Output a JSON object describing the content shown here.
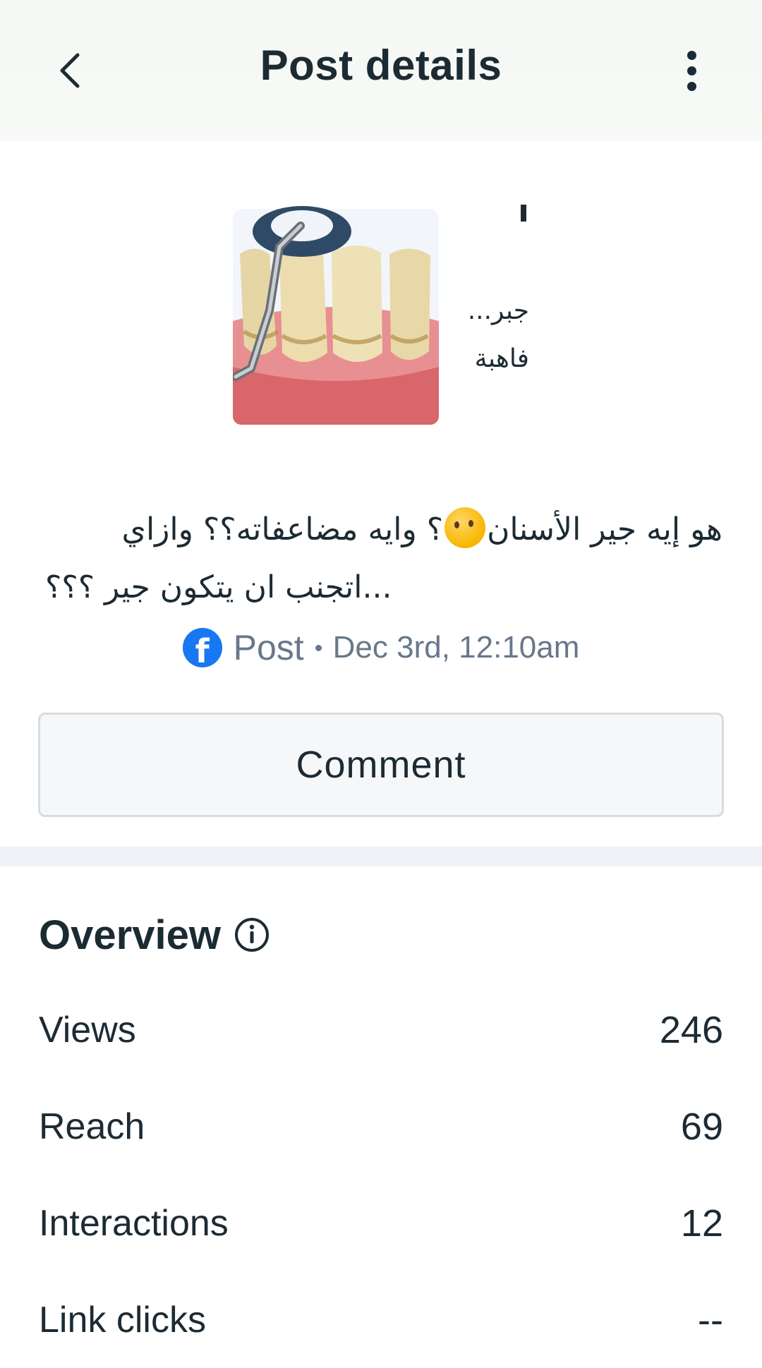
{
  "header": {
    "title": "Post details",
    "back_icon": "chevron-left-icon",
    "more_icon": "more-vertical-icon"
  },
  "post": {
    "caption_line1_part1": "هو إيه جير الأسنان",
    "caption_line1_part2": "؟ وايه مضاعفاته؟؟ وازاي",
    "caption_line2": "اتجنب ان يتكون جير ؟؟؟...",
    "thumbnail_text_1": "جبر...",
    "thumbnail_text_2": "فاهبة",
    "type": "Post",
    "date": "Dec 3rd, 12:10am",
    "platform_icon": "facebook-icon"
  },
  "actions": {
    "comment_label": "Comment"
  },
  "overview": {
    "title": "Overview",
    "metrics": [
      {
        "label": "Views",
        "value": "246"
      },
      {
        "label": "Reach",
        "value": "69"
      },
      {
        "label": "Interactions",
        "value": "12"
      },
      {
        "label": "Link clicks",
        "value": "--"
      }
    ]
  },
  "colors": {
    "text": "#1c2b33",
    "muted": "#67788a",
    "facebook": "#1877f2",
    "divider": "#eef1f8"
  }
}
